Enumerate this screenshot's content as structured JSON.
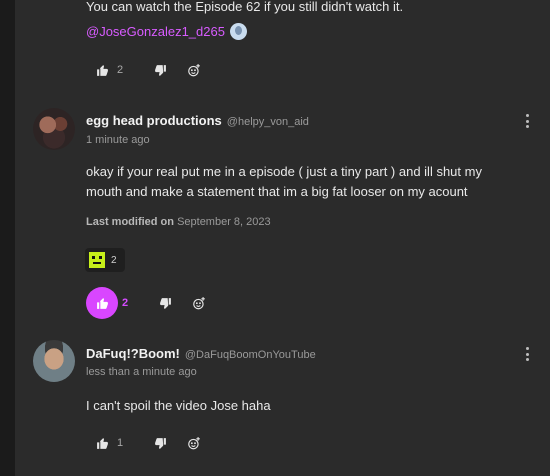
{
  "top_comment": {
    "partial_text": "You can watch the Episode 62 if you still didn't watch it.",
    "mention": "@JoseGonzalez1_d265",
    "like_count": "2"
  },
  "comments": [
    {
      "author": "egg head productions",
      "handle": "@helpy_von_aid",
      "timestamp": "1 minute ago",
      "body": "okay if your real put me in a episode ( just a tiny part ) and ill shut my mouth and make a statement that im a big fat looser on my acount",
      "modified_label": "Last modified on",
      "modified_date": "September 8, 2023",
      "reaction_count": "2",
      "like_count": "2"
    },
    {
      "author": "DaFuq!?Boom!",
      "handle": "@DaFuqBoomOnYouTube",
      "timestamp": "less than a minute ago",
      "body": "I can't spoil the video Jose haha",
      "like_count": "1"
    }
  ],
  "icons": {
    "like": "thumbs-up-icon",
    "dislike": "thumbs-down-icon",
    "react": "add-reaction-icon",
    "menu": "more-vertical-icon"
  },
  "colors": {
    "accent": "#d946ff",
    "mention": "#d85cff"
  }
}
